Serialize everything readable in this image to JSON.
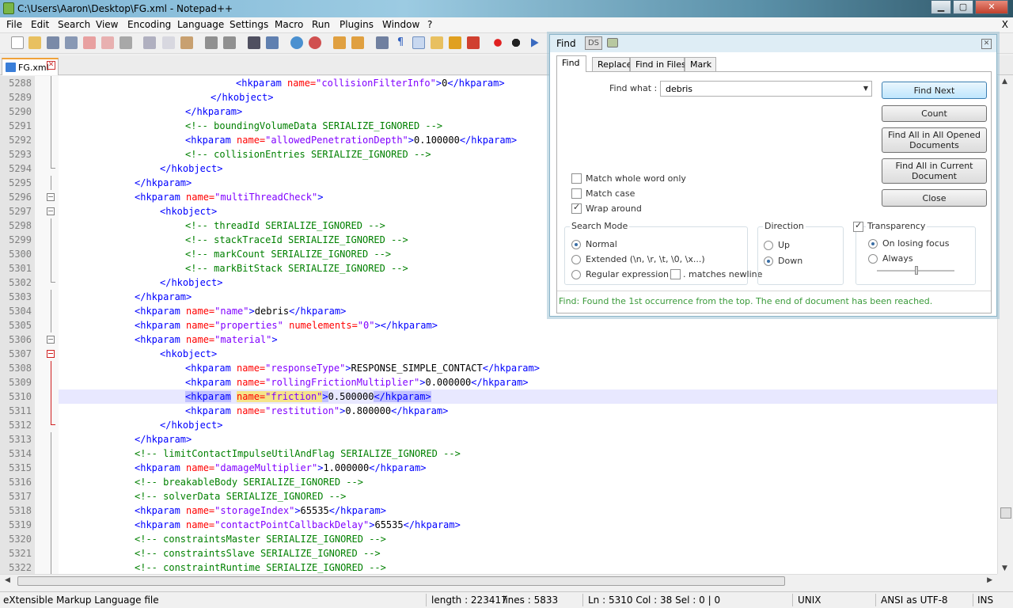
{
  "window": {
    "title": "C:\\Users\\Aaron\\Desktop\\FG.xml - Notepad++",
    "minimize_label": "▁",
    "maximize_label": "▢",
    "close_label": "✕"
  },
  "menu": {
    "items": [
      "File",
      "Edit",
      "Search",
      "View",
      "Encoding",
      "Language",
      "Settings",
      "Macro",
      "Run",
      "Plugins",
      "Window",
      "?"
    ],
    "close_doc_label": "X"
  },
  "toolbar": {
    "icons": [
      "new-icon",
      "open-icon",
      "save-icon",
      "save-all-icon",
      "close-icon",
      "close-all-icon",
      "print-icon",
      "cut-icon",
      "copy-icon",
      "paste-icon",
      "undo-icon",
      "redo-icon",
      "find-icon",
      "replace-icon",
      "zoom-in-icon",
      "zoom-out-icon",
      "sync-v-icon",
      "sync-h-icon",
      "wrap-icon",
      "all-chars-icon",
      "indent-guide-icon",
      "udl-icon",
      "doc-map-icon",
      "function-list-icon",
      "record-icon",
      "stop-icon",
      "play-icon"
    ]
  },
  "tab": {
    "label": "FG.xml",
    "close_label": "✕"
  },
  "editor": {
    "lines": [
      {
        "n": "5288",
        "tokens": [
          [
            "t",
            "<hkparam "
          ],
          [
            "a",
            "name="
          ],
          [
            "v",
            "\"collisionFilterInfo\""
          ],
          [
            "t",
            ">"
          ],
          [
            "x",
            "0"
          ],
          [
            "t",
            "</hkparam>"
          ]
        ],
        "indent": 28
      },
      {
        "n": "5289",
        "tokens": [
          [
            "t",
            "</hkobject>"
          ]
        ],
        "indent": 24
      },
      {
        "n": "5290",
        "tokens": [
          [
            "t",
            "</hkparam>"
          ]
        ],
        "indent": 20
      },
      {
        "n": "5291",
        "tokens": [
          [
            "c",
            "<!-- boundingVolumeData SERIALIZE_IGNORED -->"
          ]
        ],
        "indent": 20
      },
      {
        "n": "5292",
        "tokens": [
          [
            "t",
            "<hkparam "
          ],
          [
            "a",
            "name="
          ],
          [
            "v",
            "\"allowedPenetrationDepth\""
          ],
          [
            "t",
            ">"
          ],
          [
            "x",
            "0.100000"
          ],
          [
            "t",
            "</hkparam>"
          ]
        ],
        "indent": 20
      },
      {
        "n": "5293",
        "tokens": [
          [
            "c",
            "<!-- collisionEntries SERIALIZE_IGNORED -->"
          ]
        ],
        "indent": 20
      },
      {
        "n": "5294",
        "tokens": [
          [
            "t",
            "</hkobject>"
          ]
        ],
        "indent": 16
      },
      {
        "n": "5295",
        "tokens": [
          [
            "t",
            "</hkparam>"
          ]
        ],
        "indent": 12
      },
      {
        "n": "5296",
        "tokens": [
          [
            "t",
            "<hkparam "
          ],
          [
            "a",
            "name="
          ],
          [
            "v",
            "\"multiThreadCheck\""
          ],
          [
            "t",
            ">"
          ]
        ],
        "indent": 12
      },
      {
        "n": "5297",
        "tokens": [
          [
            "t",
            "<hkobject>"
          ]
        ],
        "indent": 16
      },
      {
        "n": "5298",
        "tokens": [
          [
            "c",
            "<!-- threadId SERIALIZE_IGNORED -->"
          ]
        ],
        "indent": 20
      },
      {
        "n": "5299",
        "tokens": [
          [
            "c",
            "<!-- stackTraceId SERIALIZE_IGNORED -->"
          ]
        ],
        "indent": 20
      },
      {
        "n": "5300",
        "tokens": [
          [
            "c",
            "<!-- markCount SERIALIZE_IGNORED -->"
          ]
        ],
        "indent": 20
      },
      {
        "n": "5301",
        "tokens": [
          [
            "c",
            "<!-- markBitStack SERIALIZE_IGNORED -->"
          ]
        ],
        "indent": 20
      },
      {
        "n": "5302",
        "tokens": [
          [
            "t",
            "</hkobject>"
          ]
        ],
        "indent": 16
      },
      {
        "n": "5303",
        "tokens": [
          [
            "t",
            "</hkparam>"
          ]
        ],
        "indent": 12
      },
      {
        "n": "5304",
        "tokens": [
          [
            "t",
            "<hkparam "
          ],
          [
            "a",
            "name="
          ],
          [
            "v",
            "\"name\""
          ],
          [
            "t",
            ">"
          ],
          [
            "x",
            "debris"
          ],
          [
            "t",
            "</hkparam>"
          ]
        ],
        "indent": 12
      },
      {
        "n": "5305",
        "tokens": [
          [
            "t",
            "<hkparam "
          ],
          [
            "a",
            "name="
          ],
          [
            "v",
            "\"properties\""
          ],
          [
            "t",
            " "
          ],
          [
            "a",
            "numelements="
          ],
          [
            "v",
            "\"0\""
          ],
          [
            "t",
            "></hkparam>"
          ]
        ],
        "indent": 12
      },
      {
        "n": "5306",
        "tokens": [
          [
            "t",
            "<hkparam "
          ],
          [
            "a",
            "name="
          ],
          [
            "v",
            "\"material\""
          ],
          [
            "t",
            ">"
          ]
        ],
        "indent": 12
      },
      {
        "n": "5307",
        "tokens": [
          [
            "t",
            "<hkobject>"
          ]
        ],
        "indent": 16
      },
      {
        "n": "5308",
        "tokens": [
          [
            "t",
            "<hkparam "
          ],
          [
            "a",
            "name="
          ],
          [
            "v",
            "\"responseType\""
          ],
          [
            "t",
            ">"
          ],
          [
            "x",
            "RESPONSE_SIMPLE_CONTACT"
          ],
          [
            "t",
            "</hkparam>"
          ]
        ],
        "indent": 20
      },
      {
        "n": "5309",
        "tokens": [
          [
            "t",
            "<hkparam "
          ],
          [
            "a",
            "name="
          ],
          [
            "v",
            "\"rollingFrictionMultiplier\""
          ],
          [
            "t",
            ">"
          ],
          [
            "x",
            "0.000000"
          ],
          [
            "t",
            "</hkparam>"
          ]
        ],
        "indent": 20
      },
      {
        "n": "5310",
        "tokens": [
          [
            "ts",
            "<hkparam"
          ],
          [
            "t",
            " "
          ],
          [
            "ah",
            "name="
          ],
          [
            "vh",
            "\"friction\""
          ],
          [
            "ts",
            ">"
          ],
          [
            "x",
            "0.500000"
          ],
          [
            "ts",
            "</hkparam>"
          ]
        ],
        "indent": 20,
        "current": true
      },
      {
        "n": "5311",
        "tokens": [
          [
            "t",
            "<hkparam "
          ],
          [
            "a",
            "name="
          ],
          [
            "v",
            "\"restitution\""
          ],
          [
            "t",
            ">"
          ],
          [
            "x",
            "0.800000"
          ],
          [
            "t",
            "</hkparam>"
          ]
        ],
        "indent": 20
      },
      {
        "n": "5312",
        "tokens": [
          [
            "t",
            "</hkobject>"
          ]
        ],
        "indent": 16
      },
      {
        "n": "5313",
        "tokens": [
          [
            "t",
            "</hkparam>"
          ]
        ],
        "indent": 12
      },
      {
        "n": "5314",
        "tokens": [
          [
            "c",
            "<!-- limitContactImpulseUtilAndFlag SERIALIZE_IGNORED -->"
          ]
        ],
        "indent": 12
      },
      {
        "n": "5315",
        "tokens": [
          [
            "t",
            "<hkparam "
          ],
          [
            "a",
            "name="
          ],
          [
            "v",
            "\"damageMultiplier\""
          ],
          [
            "t",
            ">"
          ],
          [
            "x",
            "1.000000"
          ],
          [
            "t",
            "</hkparam>"
          ]
        ],
        "indent": 12
      },
      {
        "n": "5316",
        "tokens": [
          [
            "c",
            "<!-- breakableBody SERIALIZE_IGNORED -->"
          ]
        ],
        "indent": 12
      },
      {
        "n": "5317",
        "tokens": [
          [
            "c",
            "<!-- solverData SERIALIZE_IGNORED -->"
          ]
        ],
        "indent": 12
      },
      {
        "n": "5318",
        "tokens": [
          [
            "t",
            "<hkparam "
          ],
          [
            "a",
            "name="
          ],
          [
            "v",
            "\"storageIndex\""
          ],
          [
            "t",
            ">"
          ],
          [
            "x",
            "65535"
          ],
          [
            "t",
            "</hkparam>"
          ]
        ],
        "indent": 12
      },
      {
        "n": "5319",
        "tokens": [
          [
            "t",
            "<hkparam "
          ],
          [
            "a",
            "name="
          ],
          [
            "v",
            "\"contactPointCallbackDelay\""
          ],
          [
            "t",
            ">"
          ],
          [
            "x",
            "65535"
          ],
          [
            "t",
            "</hkparam>"
          ]
        ],
        "indent": 12
      },
      {
        "n": "5320",
        "tokens": [
          [
            "c",
            "<!-- constraintsMaster SERIALIZE_IGNORED -->"
          ]
        ],
        "indent": 12
      },
      {
        "n": "5321",
        "tokens": [
          [
            "c",
            "<!-- constraintsSlave SERIALIZE_IGNORED -->"
          ]
        ],
        "indent": 12
      },
      {
        "n": "5322",
        "tokens": [
          [
            "c",
            "<!-- constraintRuntime SERIALIZE_IGNORED -->"
          ]
        ],
        "indent": 12
      }
    ]
  },
  "status": {
    "file_type": "eXtensible Markup Language file",
    "length": "length : 223417",
    "lines": "lines : 5833",
    "position": "Ln : 5310    Col : 38    Sel : 0 | 0",
    "eol": "UNIX",
    "encoding": "ANSI as UTF-8",
    "mode": "INS"
  },
  "find": {
    "title": "Find",
    "ds_label": "DS",
    "tabs": [
      "Find",
      "Replace",
      "Find in Files",
      "Mark"
    ],
    "find_what_label": "Find what :",
    "find_what_value": "debris",
    "buttons": {
      "find_next": "Find Next",
      "count": "Count",
      "find_all_opened": "Find All in All Opened Documents",
      "find_all_current": "Find All in Current Document",
      "close": "Close"
    },
    "options": {
      "match_whole_word": "Match whole word only",
      "match_case": "Match case",
      "wrap_around": "Wrap around"
    },
    "search_mode": {
      "label": "Search Mode",
      "normal": "Normal",
      "extended": "Extended (\\n, \\r, \\t, \\0, \\x...)",
      "regex": "Regular expression",
      "matches_newline": ". matches newline"
    },
    "direction": {
      "label": "Direction",
      "up": "Up",
      "down": "Down"
    },
    "transparency": {
      "label": "Transparency",
      "on_losing_focus": "On losing focus",
      "always": "Always",
      "level": 0.5
    },
    "status_message": "Find: Found the 1st occurrence from the top. The end of document has been reached."
  }
}
